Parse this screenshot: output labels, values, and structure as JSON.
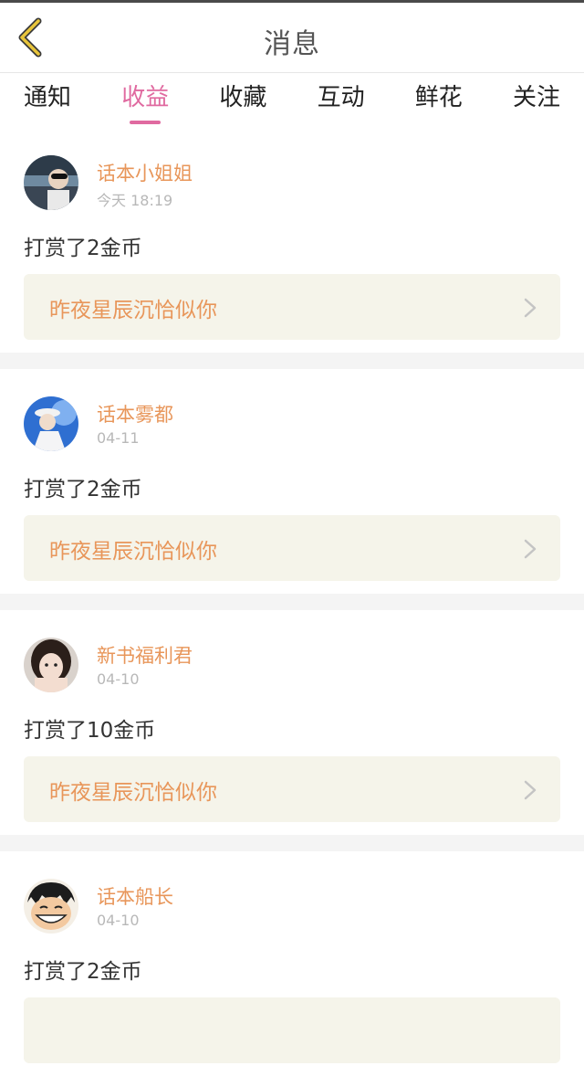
{
  "header": {
    "title": "消息"
  },
  "tabs": [
    {
      "label": "通知",
      "active": false
    },
    {
      "label": "收益",
      "active": true
    },
    {
      "label": "收藏",
      "active": false
    },
    {
      "label": "互动",
      "active": false
    },
    {
      "label": "鲜花",
      "active": false
    },
    {
      "label": "关注",
      "active": false
    }
  ],
  "messages": [
    {
      "username": "话本小姐姐",
      "time": "今天 18:19",
      "action": "打赏了2金币",
      "book": "昨夜星辰沉恰似你"
    },
    {
      "username": "话本雾都",
      "time": "04-11",
      "action": "打赏了2金币",
      "book": "昨夜星辰沉恰似你"
    },
    {
      "username": "新书福利君",
      "time": "04-10",
      "action": "打赏了10金币",
      "book": "昨夜星辰沉恰似你"
    },
    {
      "username": "话本船长",
      "time": "04-10",
      "action": "打赏了2金币",
      "book": ""
    }
  ],
  "colors": {
    "accent_pink": "#e06aa0",
    "username_orange": "#e8965a",
    "back_arrow": "#e8c53a",
    "book_bg": "#f5f4ea"
  },
  "icons": {
    "back": "back-arrow-icon",
    "chevron": "chevron-right-icon"
  }
}
